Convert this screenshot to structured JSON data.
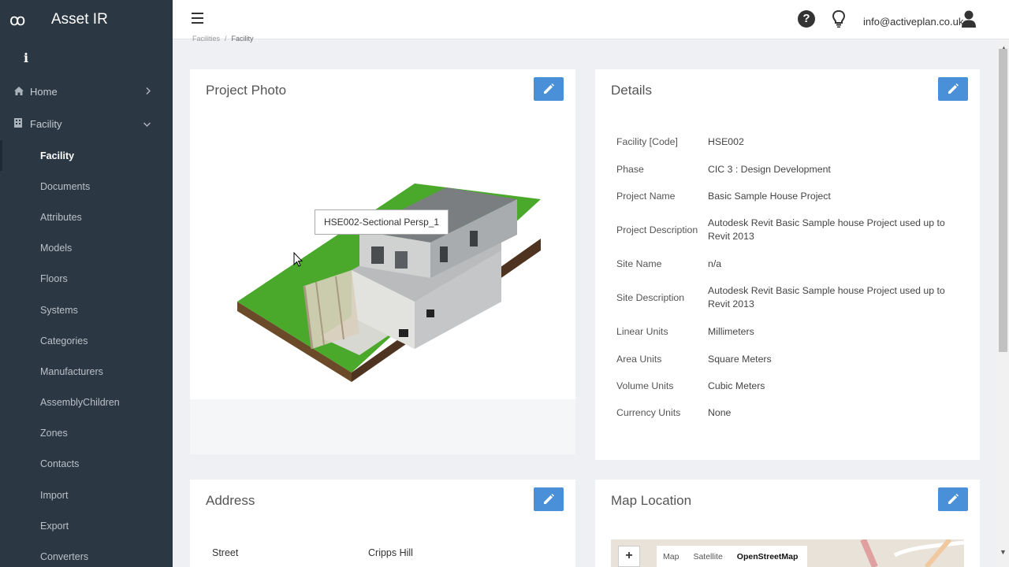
{
  "app": {
    "logo_glyph": "ꝏ",
    "name": "Asset IR",
    "info_glyph": "i"
  },
  "sidebar": {
    "home": {
      "label": "Home",
      "icon": "home-icon"
    },
    "facility": {
      "label": "Facility",
      "icon": "building-icon"
    },
    "sub_items": [
      {
        "label": "Facility",
        "active": true
      },
      {
        "label": "Documents"
      },
      {
        "label": "Attributes"
      },
      {
        "label": "Models"
      },
      {
        "label": "Floors"
      },
      {
        "label": "Systems"
      },
      {
        "label": "Categories"
      },
      {
        "label": "Manufacturers"
      },
      {
        "label": "AssemblyChildren"
      },
      {
        "label": "Zones"
      },
      {
        "label": "Contacts"
      },
      {
        "label": "Import"
      },
      {
        "label": "Export"
      },
      {
        "label": "Converters"
      }
    ]
  },
  "topbar": {
    "help_glyph": "?",
    "user_email": "info@activeplan.co.uk"
  },
  "breadcrumb": {
    "parent": "Facilities",
    "current": "Facility"
  },
  "project_photo": {
    "title": "Project Photo",
    "tooltip": "HSE002-Sectional Persp_1"
  },
  "details": {
    "title": "Details",
    "rows": [
      {
        "label": "Facility [Code]",
        "value": "HSE002"
      },
      {
        "label": "Phase",
        "value": "CIC 3 : Design Development"
      },
      {
        "label": "Project Name",
        "value": "Basic Sample House Project"
      },
      {
        "label": "Project Description",
        "value": "Autodesk Revit Basic Sample house Project used up to Revit 2013"
      },
      {
        "label": "Site Name",
        "value": "n/a"
      },
      {
        "label": "Site Description",
        "value": "Autodesk Revit Basic Sample house Project used up to Revit 2013"
      },
      {
        "label": "Linear Units",
        "value": "Millimeters"
      },
      {
        "label": "Area Units",
        "value": "Square Meters"
      },
      {
        "label": "Volume Units",
        "value": "Cubic Meters"
      },
      {
        "label": "Currency Units",
        "value": "None"
      }
    ]
  },
  "address": {
    "title": "Address",
    "street_label": "Street",
    "street_value": "Cripps Hill"
  },
  "map": {
    "title": "Map Location",
    "zoom_in": "+",
    "tabs": [
      "Map",
      "Satellite",
      "OpenStreetMap"
    ],
    "active_tab": "OpenStreetMap"
  },
  "colors": {
    "sidebar_bg": "#2b3743",
    "accent": "#4a90d9",
    "page_bg": "#eef0f4"
  }
}
